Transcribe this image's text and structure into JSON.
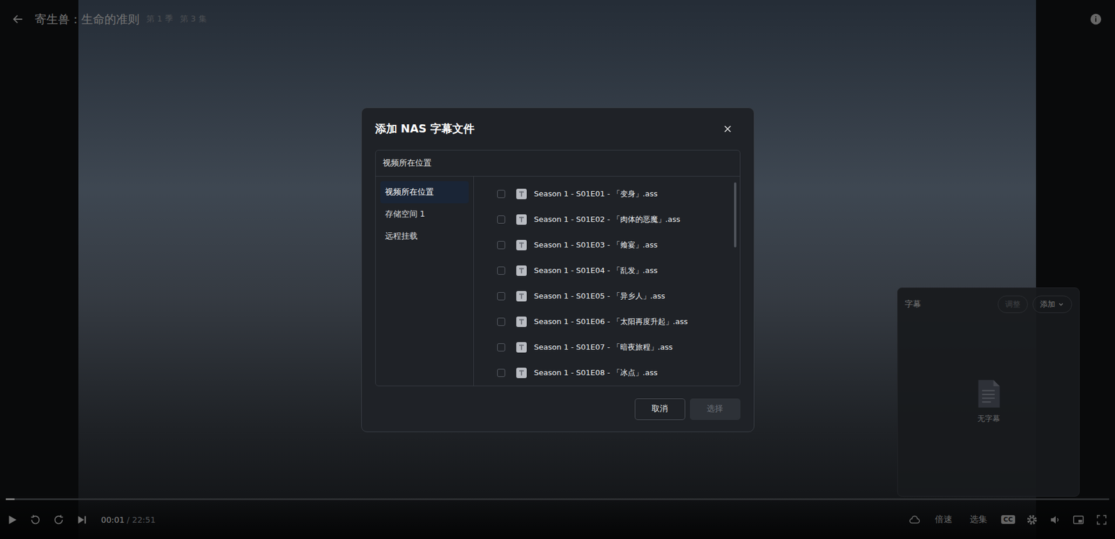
{
  "player": {
    "title": "寄生兽：生命的准则",
    "season": "第 1 季",
    "episode": "第 3 集"
  },
  "controls": {
    "current": "00:01",
    "total": "/ 22:51",
    "progress": {
      "level": 0.008
    },
    "options": [
      "倍速",
      "选集"
    ],
    "cc": "CC"
  },
  "subtitle_panel": {
    "title": "字幕",
    "buttons": [
      {
        "label": "调整",
        "disabled": true,
        "dropdown": false
      },
      {
        "label": "添加",
        "disabled": false,
        "dropdown": true
      }
    ],
    "empty": "无字幕"
  },
  "dialog": {
    "title": "添加 NAS 字幕文件",
    "location": "视频所在位置",
    "sidebar": [
      {
        "label": "视频所在位置",
        "selected": true
      },
      {
        "label": "存储空间 1",
        "selected": false
      },
      {
        "label": "远程挂载",
        "selected": false
      }
    ],
    "files": [
      {
        "name": "Season 1 - S01E01 - 「变身」.ass",
        "checked": false
      },
      {
        "name": "Season 1 - S01E02 - 「肉体的恶魔」.ass",
        "checked": false
      },
      {
        "name": "Season 1 - S01E03 - 「飨宴」.ass",
        "checked": false
      },
      {
        "name": "Season 1 - S01E04 - 「乱发」.ass",
        "checked": false
      },
      {
        "name": "Season 1 - S01E05 - 「异乡人」.ass",
        "checked": false
      },
      {
        "name": "Season 1 - S01E06 - 「太阳再度升起」.ass",
        "checked": false
      },
      {
        "name": "Season 1 - S01E07 - 「暗夜旅程」.ass",
        "checked": false
      },
      {
        "name": "Season 1 - S01E08 - 「冰点」.ass",
        "checked": false
      }
    ],
    "buttons": [
      {
        "label": "取消",
        "disabled": false
      },
      {
        "label": "选择",
        "disabled": true
      }
    ]
  }
}
